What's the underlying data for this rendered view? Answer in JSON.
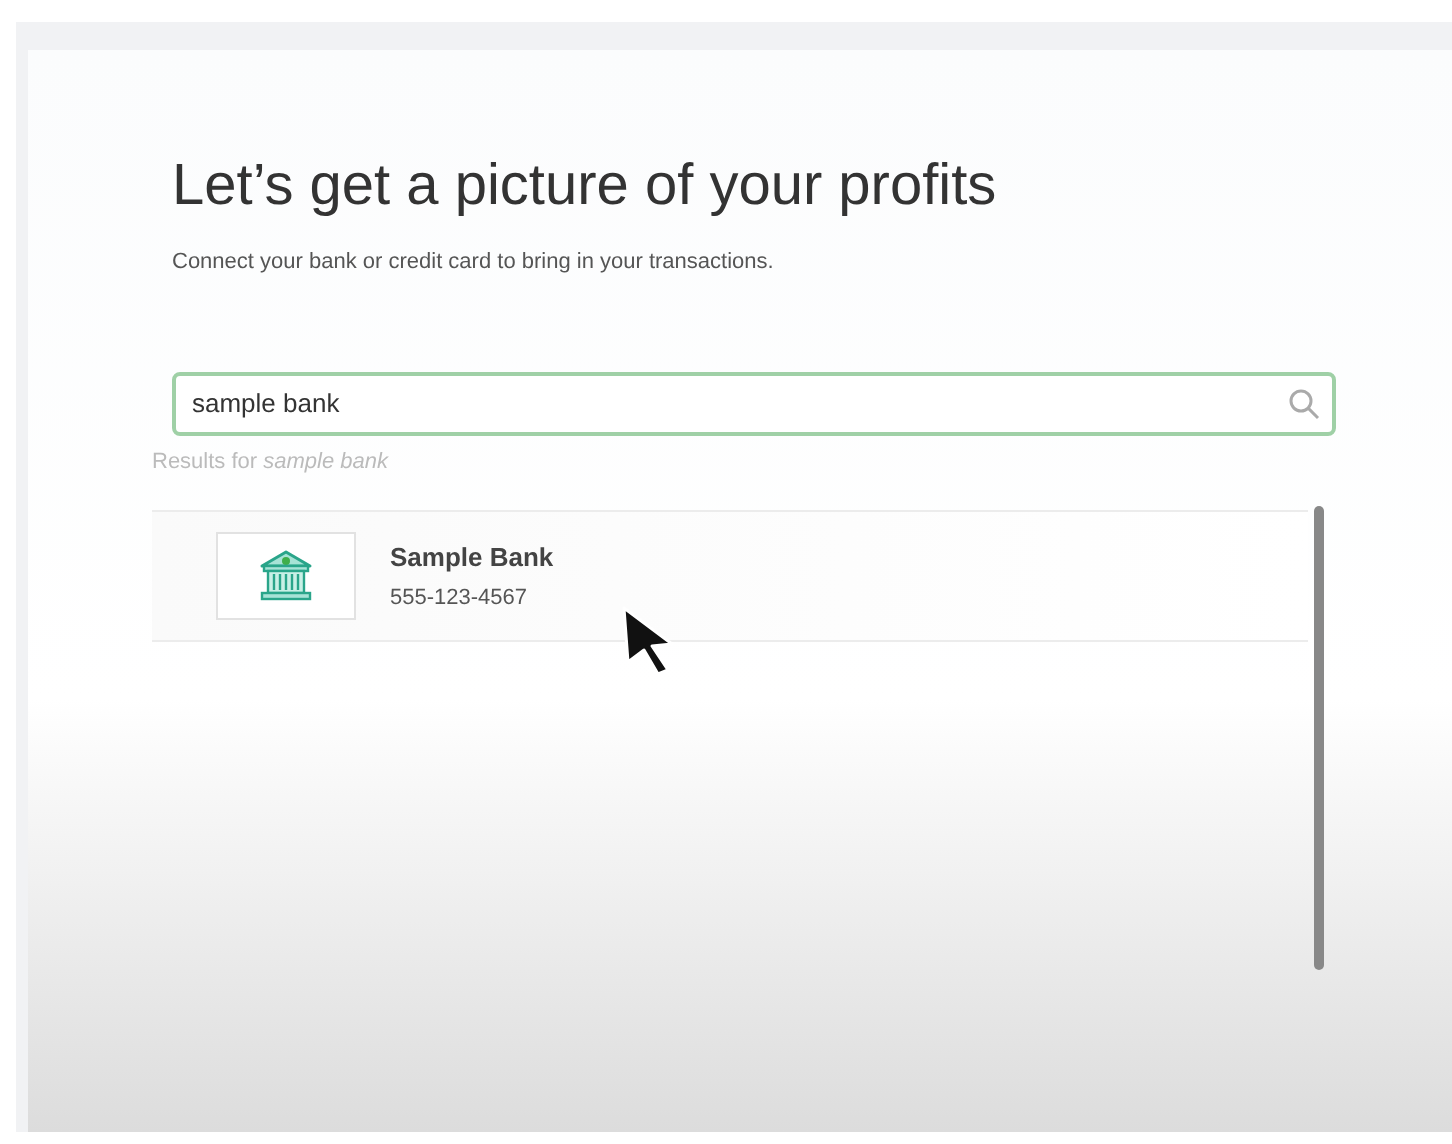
{
  "title": "Let’s get a picture of your profits",
  "subtitle": "Connect your bank or credit card to bring in your transactions.",
  "search": {
    "value": "sample bank"
  },
  "results_label": "Results for *sample bank*",
  "results": [
    {
      "name": "Sample Bank",
      "phone": "555-123-4567"
    }
  ]
}
